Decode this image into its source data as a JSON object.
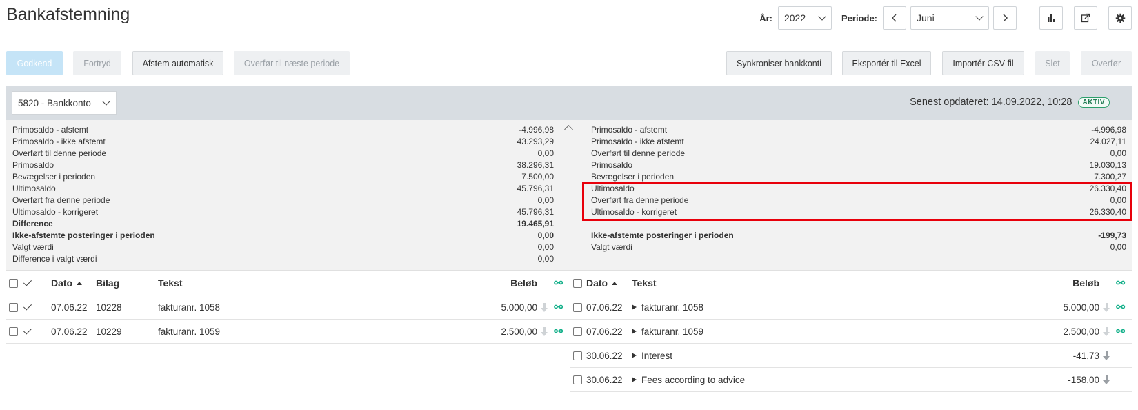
{
  "page": {
    "title": "Bankafstemning"
  },
  "header": {
    "year_label": "År:",
    "year_value": "2022",
    "period_label": "Periode:",
    "period_value": "Juni",
    "icons": [
      "chevron-left-icon",
      "chevron-right-icon",
      "bar-chart-icon",
      "external-link-icon",
      "gear-icon"
    ]
  },
  "toolbar": {
    "approve": "Godkend",
    "undo": "Fortryd",
    "auto_reconcile": "Afstem automatisk",
    "transfer_next": "Overfør til næste periode",
    "sync_accounts": "Synkroniser bankkonti",
    "export_excel": "Eksportér til Excel",
    "import_csv": "Importér CSV-fil",
    "delete": "Slet",
    "transfer": "Overfør"
  },
  "account": {
    "selected": "5820 - Bankkonto",
    "last_updated": "Senest opdateret: 14.09.2022, 10:28",
    "status_badge": "AKTIV"
  },
  "summary_left": [
    {
      "label": "Primosaldo - afstemt",
      "value": "-4.996,98",
      "bold": false
    },
    {
      "label": "Primosaldo - ikke afstemt",
      "value": "43.293,29",
      "bold": false
    },
    {
      "label": "Overført til denne periode",
      "value": "0,00",
      "bold": false
    },
    {
      "label": "Primosaldo",
      "value": "38.296,31",
      "bold": false
    },
    {
      "label": "Bevægelser i perioden",
      "value": "7.500,00",
      "bold": false
    },
    {
      "label": "Ultimosaldo",
      "value": "45.796,31",
      "bold": false
    },
    {
      "label": "Overført fra denne periode",
      "value": "0,00",
      "bold": false
    },
    {
      "label": "Ultimosaldo - korrigeret",
      "value": "45.796,31",
      "bold": false
    },
    {
      "label": "Difference",
      "value": "19.465,91",
      "bold": true
    },
    {
      "label": "Ikke-afstemte posteringer i perioden",
      "value": "0,00",
      "bold": true
    },
    {
      "label": "Valgt værdi",
      "value": "0,00",
      "bold": false
    },
    {
      "label": "Difference i valgt værdi",
      "value": "0,00",
      "bold": false
    }
  ],
  "summary_right": [
    {
      "label": "Primosaldo - afstemt",
      "value": "-4.996,98",
      "bold": false
    },
    {
      "label": "Primosaldo - ikke afstemt",
      "value": "24.027,11",
      "bold": false
    },
    {
      "label": "Overført til denne periode",
      "value": "0,00",
      "bold": false
    },
    {
      "label": "Primosaldo",
      "value": "19.030,13",
      "bold": false
    },
    {
      "label": "Bevægelser i perioden",
      "value": "7.300,27",
      "bold": false
    },
    {
      "label": "Ultimosaldo",
      "value": "26.330,40",
      "bold": false
    },
    {
      "label": "Overført fra denne periode",
      "value": "0,00",
      "bold": false
    },
    {
      "label": "Ultimosaldo - korrigeret",
      "value": "26.330,40",
      "bold": false
    },
    {
      "label": "",
      "value": "",
      "bold": false
    },
    {
      "label": "Ikke-afstemte posteringer i perioden",
      "value": "-199,73",
      "bold": true
    },
    {
      "label": "Valgt værdi",
      "value": "0,00",
      "bold": false
    }
  ],
  "ledger_table": {
    "headers": {
      "date": "Dato",
      "voucher": "Bilag",
      "text": "Tekst",
      "amount": "Beløb"
    },
    "rows": [
      {
        "date": "07.06.22",
        "voucher": "10228",
        "text": "fakturanr. 1058",
        "amount": "5.000,00"
      },
      {
        "date": "07.06.22",
        "voucher": "10229",
        "text": "fakturanr. 1059",
        "amount": "2.500,00"
      }
    ]
  },
  "bank_table": {
    "headers": {
      "date": "Dato",
      "text": "Tekst",
      "amount": "Beløb"
    },
    "rows": [
      {
        "date": "07.06.22",
        "text": "fakturanr. 1058",
        "amount": "5.000,00",
        "linked": true
      },
      {
        "date": "07.06.22",
        "text": "fakturanr. 1059",
        "amount": "2.500,00",
        "linked": true
      },
      {
        "date": "30.06.22",
        "text": "Interest",
        "amount": "-41,73",
        "linked": false
      },
      {
        "date": "30.06.22",
        "text": "Fees according to advice",
        "amount": "-158,00",
        "linked": false
      }
    ]
  },
  "colors": {
    "accent_green": "#14b08a",
    "highlight_red": "#e8000b",
    "primary_disabled": "#c5e4f7"
  }
}
